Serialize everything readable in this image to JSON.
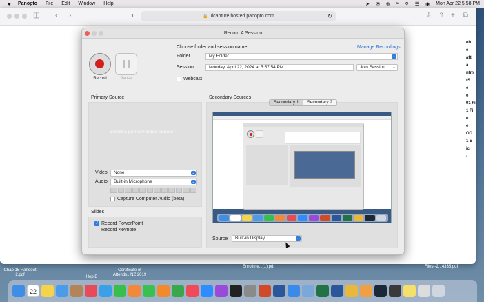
{
  "menubar": {
    "app_name": "Panopto",
    "items": [
      "File",
      "Edit",
      "Window",
      "Help"
    ],
    "clock": "Mon Apr 22  5:58 PM"
  },
  "browser": {
    "address": "uicapture.hosted.panopto.com",
    "side_text": [
      "eb",
      "e",
      "afti",
      "a",
      "ntm",
      "tS",
      "e",
      "e",
      "01 Fi",
      "1 Fi",
      "e",
      "e",
      "OD",
      "1 5",
      "ic",
      "-"
    ]
  },
  "dialog": {
    "title": "Record A Session",
    "record_label": "Record",
    "pause_label": "Pause",
    "choose_folder_label": "Choose folder and session name",
    "manage_recordings": "Manage Recordings",
    "folder_label": "Folder",
    "folder_value": "My Folder",
    "session_label": "Session",
    "session_value": "Monday, April 22, 2024 at 5:57:54 PM",
    "join_session": "Join Session",
    "webcast_label": "Webcast",
    "webcast_checked": false,
    "primary": {
      "title": "Primary Source",
      "placeholder": "Select a primary video source",
      "video_label": "Video",
      "video_value": "None",
      "audio_label": "Audio",
      "audio_value": "Built-in Microphone",
      "capture_audio_label": "Capture Computer Audio (beta)",
      "capture_audio_checked": false
    },
    "slides": {
      "title": "Slides",
      "powerpoint_label": "Record PowerPoint",
      "powerpoint_checked": true,
      "keynote_label": "Record Keynote",
      "keynote_checked": false
    },
    "secondary": {
      "title": "Secondary Sources",
      "tabs": [
        "Secondary 1",
        "Secondary 2"
      ],
      "selected_tab": 0,
      "source_label": "Source",
      "source_value": "Built-in Display"
    }
  },
  "desktop": {
    "files": [
      {
        "name": "Chap 15 Handout 2.pdf"
      },
      {
        "name": "Hep B"
      },
      {
        "name": "Certificate of Attends...NZ 2019"
      },
      {
        "name": "Enrollme...(1).pdf"
      },
      {
        "name": "Files--2...4335.pdf"
      }
    ]
  },
  "dock": {
    "calendar_day": "22",
    "icons": [
      "finder-icon",
      "calendar-icon",
      "notes-icon",
      "mail-icon",
      "contacts-icon",
      "news-icon",
      "safari-icon",
      "messages-icon",
      "photos-icon",
      "facetime-icon",
      "books-icon",
      "numbers-icon",
      "music-icon",
      "zoom-icon",
      "podcasts-icon",
      "tv-icon",
      "system-settings-icon",
      "powerpoint-icon",
      "word-icon",
      "app-store-icon",
      "preview-icon",
      "excel-icon",
      "word2-icon",
      "chrome-icon",
      "pages-icon",
      "steam-icon",
      "activity-icon",
      "notes2-icon",
      "finder2-icon",
      "trash-icon"
    ],
    "colors": {
      "finder-icon": "#3f8ee6",
      "calendar-icon": "#ffffff",
      "notes-icon": "#f5d34a",
      "mail-icon": "#4a9be8",
      "contacts-icon": "#b28558",
      "news-icon": "#e84a5a",
      "safari-icon": "#3aa0e8",
      "messages-icon": "#36c04a",
      "photos-icon": "#f08a3a",
      "facetime-icon": "#3ac050",
      "books-icon": "#f08a2a",
      "numbers-icon": "#3aa84a",
      "music-icon": "#f04a5a",
      "zoom-icon": "#2d8cff",
      "podcasts-icon": "#9a4ad8",
      "tv-icon": "#222222",
      "system-settings-icon": "#8a8a8a",
      "powerpoint-icon": "#d04a2a",
      "word-icon": "#2b579a",
      "app-store-icon": "#3a8ae8",
      "preview-icon": "#7aa8d8",
      "excel-icon": "#217346",
      "word2-icon": "#2b579a",
      "chrome-icon": "#e8b83a",
      "pages-icon": "#f0a040",
      "steam-icon": "#1b2838",
      "activity-icon": "#3a3a3a",
      "notes2-icon": "#f5e06a",
      "finder2-icon": "#dcdcdc",
      "trash-icon": "#cfd6df"
    }
  }
}
